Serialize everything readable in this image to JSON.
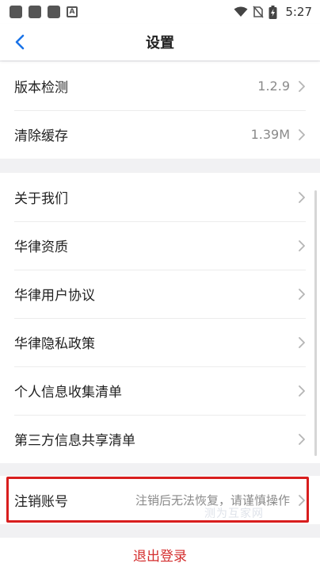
{
  "status_bar": {
    "time": "5:27",
    "a_icon_text": "A",
    "icons": [
      "app-square-icon",
      "app-square-icon",
      "app-square-icon",
      "a-notification-icon",
      "wifi-icon",
      "no-sim-icon",
      "battery-charging-icon"
    ]
  },
  "header": {
    "title": "设置",
    "back_icon": "chevron-left-icon"
  },
  "groups": [
    {
      "items": [
        {
          "label": "版本检测",
          "value": "1.2.9"
        },
        {
          "label": "清除缓存",
          "value": "1.39M"
        }
      ]
    },
    {
      "items": [
        {
          "label": "关于我们",
          "value": ""
        },
        {
          "label": "华律资质",
          "value": ""
        },
        {
          "label": "华律用户协议",
          "value": ""
        },
        {
          "label": "华律隐私政策",
          "value": ""
        },
        {
          "label": "个人信息收集清单",
          "value": ""
        },
        {
          "label": "第三方信息共享清单",
          "value": ""
        }
      ]
    },
    {
      "items": [
        {
          "label": "注销账号",
          "value": "注销后无法恢复，请谨慎操作"
        }
      ]
    }
  ],
  "footer": {
    "logout_label": "退出登录"
  },
  "watermark": "测为互家网",
  "colors": {
    "accent": "#1a73e8",
    "danger": "#d42e2e",
    "highlight_border": "#d81e1e",
    "background": "#f1f1f3"
  }
}
